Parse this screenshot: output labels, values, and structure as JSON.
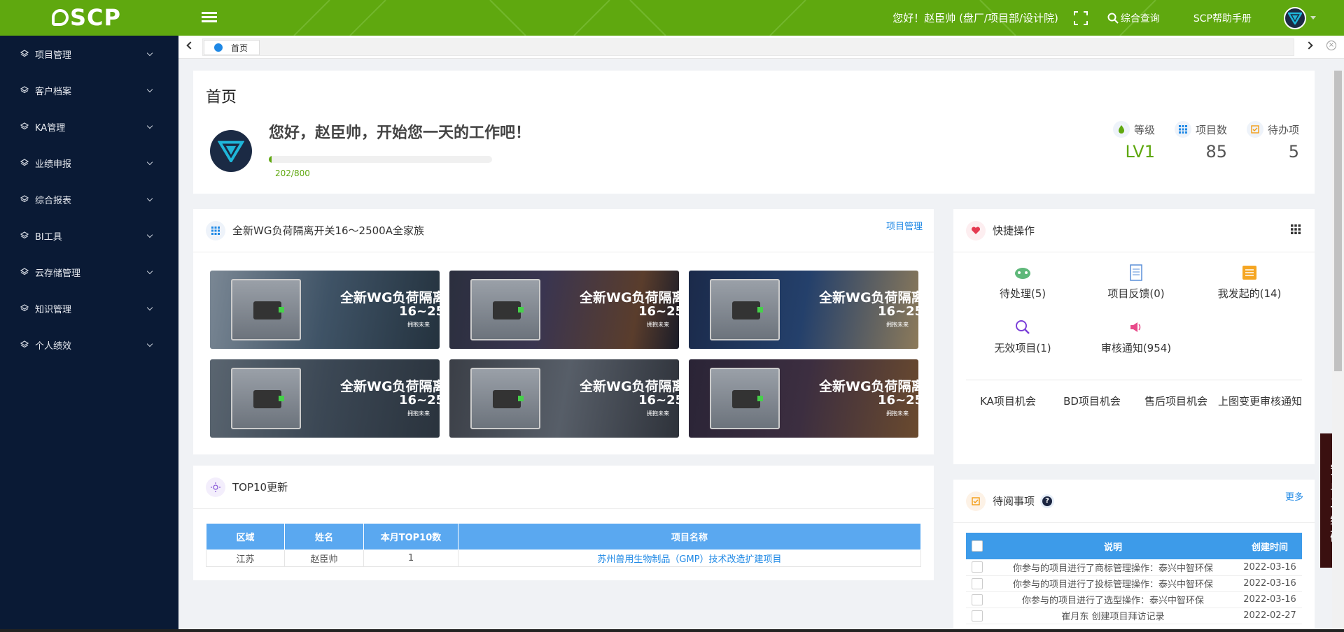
{
  "header": {
    "logo_text": "SCP",
    "greeting": "您好！赵臣帅 (盘厂/项目部/设计院)",
    "search_label": "综合查询",
    "manual_label": "SCP帮助手册"
  },
  "sidebar": {
    "items": [
      {
        "label": "项目管理"
      },
      {
        "label": "客户档案"
      },
      {
        "label": "KA管理"
      },
      {
        "label": "业绩申报"
      },
      {
        "label": "综合报表"
      },
      {
        "label": "BI工具"
      },
      {
        "label": "云存储管理"
      },
      {
        "label": "知识管理"
      },
      {
        "label": "个人绩效"
      }
    ]
  },
  "tabs": {
    "active": "首页"
  },
  "welcome": {
    "page_title": "首页",
    "hello": "您好，赵臣帅，开始您一天的工作吧！",
    "progress_text": "202/800",
    "progress_fraction": 0.0125,
    "stats": [
      {
        "label": "等级",
        "value": "LV1"
      },
      {
        "label": "项目数",
        "value": "85"
      },
      {
        "label": "待办项",
        "value": "5"
      }
    ]
  },
  "banners": {
    "title": "全新WG负荷隔离开关16～2500A全家族",
    "link": "项目管理",
    "banner_title": "全新WG负荷隔离开",
    "banner_sub": "16~25",
    "banner_tag": "拥抱未来"
  },
  "quick": {
    "title": "快捷操作",
    "ops": [
      {
        "label": "待处理(5)",
        "icon": "gamepad-icon"
      },
      {
        "label": "项目反馈(0)",
        "icon": "document-icon"
      },
      {
        "label": "我发起的(14)",
        "icon": "list-icon"
      },
      {
        "label": "无效项目(1)",
        "icon": "search-icon"
      },
      {
        "label": "审核通知(954)",
        "icon": "speaker-icon"
      }
    ],
    "links": [
      "KA项目机会",
      "BD项目机会",
      "售后项目机会",
      "上图变更审核通知"
    ]
  },
  "top10": {
    "title": "TOP10更新",
    "columns": [
      "区域",
      "姓名",
      "本月TOP10数",
      "项目名称"
    ],
    "rows": [
      {
        "region": "江苏",
        "name": "赵臣帅",
        "count": "1",
        "project": "苏州兽用生物制品（GMP）技术改造扩建项目"
      }
    ]
  },
  "pending": {
    "title": "待阅事项",
    "more": "更多",
    "columns": [
      "说明",
      "创建时间"
    ],
    "rows": [
      {
        "desc": "你参与的项目进行了商标管理操作：泰兴中智环保",
        "time": "2022-03-16"
      },
      {
        "desc": "你参与的项目进行了投标管理操作：泰兴中智环保",
        "time": "2022-03-16"
      },
      {
        "desc": "你参与的项目进行了选型操作：泰兴中智环保",
        "time": "2022-03-16"
      },
      {
        "desc": "崔月东 创建项目拜访记录",
        "time": "2022-02-27"
      }
    ]
  },
  "qr_tab": "安卓二维码",
  "colors": {
    "brand_green": "#5fa80f",
    "sidebar_bg": "#0a1a35",
    "table_blue": "#5aa8f0"
  }
}
